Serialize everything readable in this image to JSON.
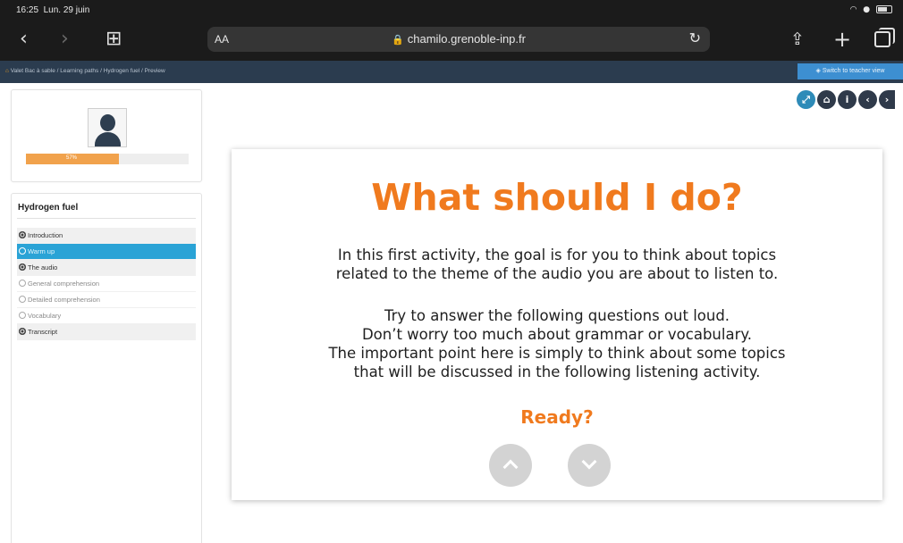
{
  "status_bar": {
    "time": "16:25",
    "date": "Lun. 29 juin"
  },
  "browser": {
    "text_size_label": "AA",
    "url": "chamilo.grenoble-inp.fr"
  },
  "breadcrumb": {
    "items": [
      "Valet Bac à sable",
      "Learning paths",
      "Hydrogen fuel",
      "Preview"
    ],
    "switch_button": "Switch to teacher view"
  },
  "sidebar": {
    "progress_percent": 57,
    "progress_label": "57%",
    "course_title": "Hydrogen fuel",
    "items": [
      {
        "label": "Introduction",
        "state": "done"
      },
      {
        "label": "Warm up",
        "state": "current"
      },
      {
        "label": "The audio",
        "state": "done"
      },
      {
        "label": "General comprehension",
        "state": "todo"
      },
      {
        "label": "Detailed comprehension",
        "state": "todo"
      },
      {
        "label": "Vocabulary",
        "state": "todo"
      },
      {
        "label": "Transcript",
        "state": "done"
      }
    ]
  },
  "actions": [
    "expand-icon",
    "home-icon",
    "info-icon",
    "previous-icon",
    "next-icon"
  ],
  "content": {
    "title": "What should I do?",
    "paragraph1": [
      "In this first activity, the goal is for you to think about topics",
      "related to the theme of the audio you are about to listen to."
    ],
    "paragraph2": [
      "Try to answer the following questions out loud.",
      "Don’t worry too much about grammar or vocabulary.",
      "The important point here is simply to think about some topics",
      "that will be discussed in the following listening activity."
    ],
    "ready": "Ready?"
  },
  "colors": {
    "accent": "#f07a1e",
    "nav_current": "#2aa3d6",
    "header": "#2b3c4f"
  }
}
